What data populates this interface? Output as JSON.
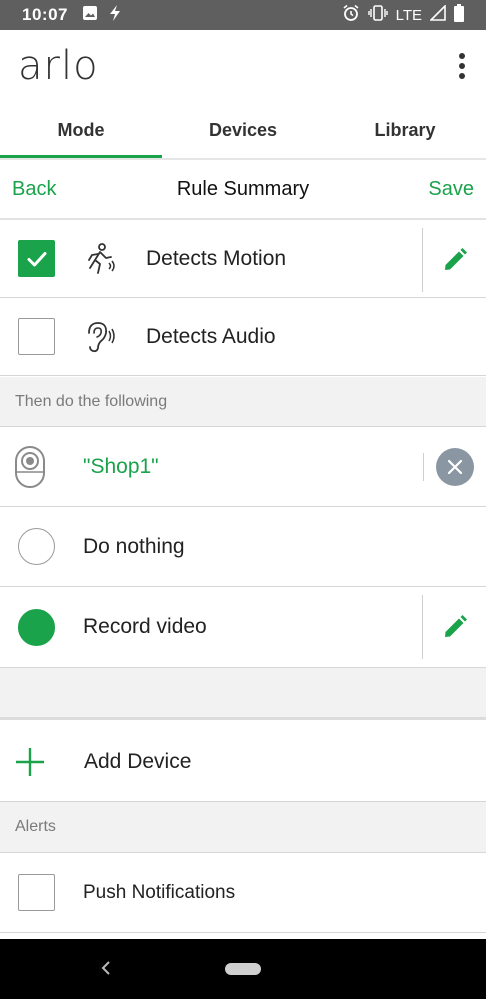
{
  "status_bar": {
    "time": "10:07",
    "network": "LTE",
    "icons": [
      "image-icon",
      "flash-icon",
      "alarm-icon",
      "vibrate-icon",
      "signal-icon",
      "battery-icon"
    ]
  },
  "app": {
    "logo": "arlo",
    "menu_icon": "more-vert-icon"
  },
  "tabs": [
    {
      "label": "Mode",
      "active": true
    },
    {
      "label": "Devices",
      "active": false
    },
    {
      "label": "Library",
      "active": false
    }
  ],
  "subbar": {
    "back": "Back",
    "title": "Rule Summary",
    "save": "Save"
  },
  "triggers": [
    {
      "label": "Detects Motion",
      "checked": true,
      "icon": "motion-icon",
      "editable": true
    },
    {
      "label": "Detects Audio",
      "checked": false,
      "icon": "audio-ear-icon",
      "editable": false
    }
  ],
  "then_header": "Then do the following",
  "device": {
    "name": "\"Shop1\"",
    "icon": "camera-icon",
    "remove_icon": "close-icon"
  },
  "actions": [
    {
      "label": "Do nothing",
      "selected": false,
      "editable": false
    },
    {
      "label": "Record video",
      "selected": true,
      "editable": true
    }
  ],
  "add_device": "Add Device",
  "alerts_header": "Alerts",
  "alerts": [
    {
      "label": "Push Notifications",
      "checked": false
    }
  ],
  "colors": {
    "accent": "#1aa34a",
    "status_bar": "#5f5f5f",
    "section_bg": "#f2f2f2",
    "remove_button": "#8a97a2"
  }
}
